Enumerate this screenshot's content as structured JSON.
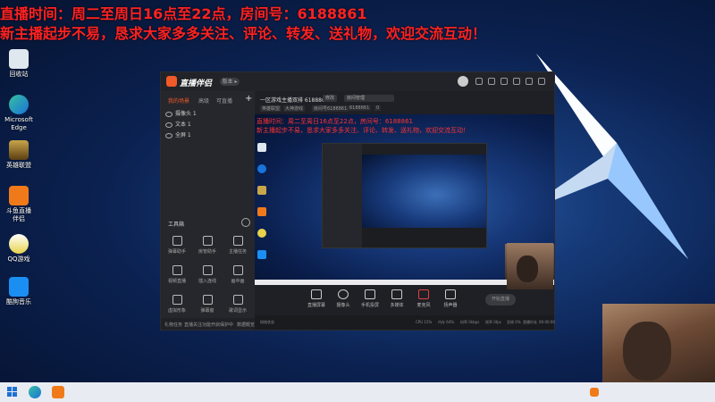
{
  "overlay": {
    "line1": "直播时间：周二至周日16点至22点，房间号：6188861",
    "line2": "新主播起步不易，恳求大家多多关注、评论、转发、送礼物，欢迎交流互动！"
  },
  "desktop_icons": [
    {
      "label": "回收站",
      "icon": "recycle-bin-icon"
    },
    {
      "label": "Microsoft Edge",
      "icon": "edge-icon"
    },
    {
      "label": "英雄联盟",
      "icon": "league-icon"
    },
    {
      "label": "斗鱼直播伴侣",
      "icon": "douyu-icon"
    },
    {
      "label": "QQ游戏",
      "icon": "qq-game-icon"
    },
    {
      "label": "酷狗音乐",
      "icon": "kugou-icon"
    }
  ],
  "app": {
    "name": "直播伴侣",
    "version_pill": "版本 ▸"
  },
  "left_panel": {
    "tabs": [
      "我的场景",
      "高级",
      "可直播"
    ],
    "sources": [
      "摄像头 1",
      "文本 1",
      "全屏 1"
    ],
    "tools_title": "工具箱",
    "tools": [
      "弹幕助手",
      "房管助手",
      "主播任务",
      "视频直播",
      "插入连线",
      "画中画",
      "虚拟形象",
      "弹幕窗",
      "歌词显示",
      "PK助手",
      "录像",
      "更多"
    ],
    "bottom_left": "礼物任务",
    "bottom_mid": "直播关注功能开启保护中",
    "bottom_right": "数据概览"
  },
  "top_info": {
    "title": "一区游戏主播双排 6188861",
    "btn1": "修改",
    "btn2": "房间管理",
    "tags": [
      "英雄联盟",
      "大神游戏",
      "房间号6188861",
      "6188861"
    ],
    "count": "0"
  },
  "preview_overlay": {
    "line1": "直播时间：周二至周日16点至22点，房间号：6188861",
    "line2": "新主播起步不易，恳求大家多多关注、评论、转发、送礼物，欢迎交流互动！"
  },
  "controls": {
    "buttons": [
      "直播屏幕",
      "摄像头",
      "手机投屏",
      "多媒体",
      "麦克风",
      "扬声器"
    ],
    "go_live": "开始直播"
  },
  "status": {
    "items": [
      "网络状态",
      "CPU 15%",
      "内存 64%",
      "码率 0kbps",
      "帧率 0fps",
      "丢帧 0%",
      "直播时长",
      "00:00:00"
    ]
  },
  "colors": {
    "accent": "#f15a29",
    "overlay_red": "#ff2222"
  }
}
